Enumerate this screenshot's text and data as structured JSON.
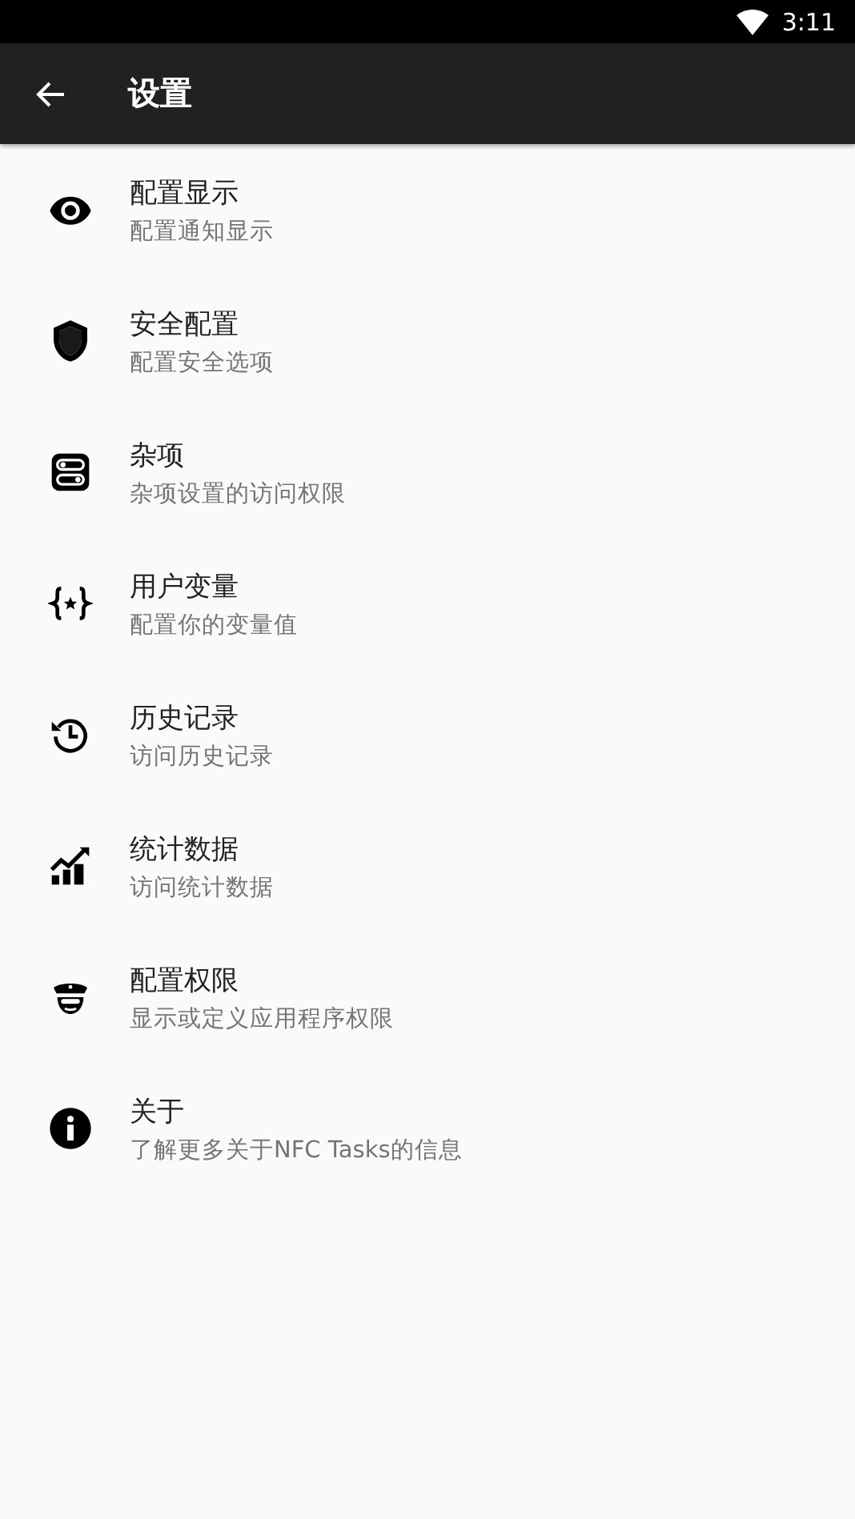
{
  "status_bar": {
    "time": "3:11"
  },
  "app_bar": {
    "title": "设置"
  },
  "items": [
    {
      "title": "配置显示",
      "subtitle": "配置通知显示"
    },
    {
      "title": "安全配置",
      "subtitle": "配置安全选项"
    },
    {
      "title": "杂项",
      "subtitle": "杂项设置的访问权限"
    },
    {
      "title": "用户变量",
      "subtitle": "配置你的变量值"
    },
    {
      "title": "历史记录",
      "subtitle": "访问历史记录"
    },
    {
      "title": "统计数据",
      "subtitle": "访问统计数据"
    },
    {
      "title": "配置权限",
      "subtitle": "显示或定义应用程序权限"
    },
    {
      "title": "关于",
      "subtitle": "了解更多关于NFC Tasks的信息"
    }
  ]
}
